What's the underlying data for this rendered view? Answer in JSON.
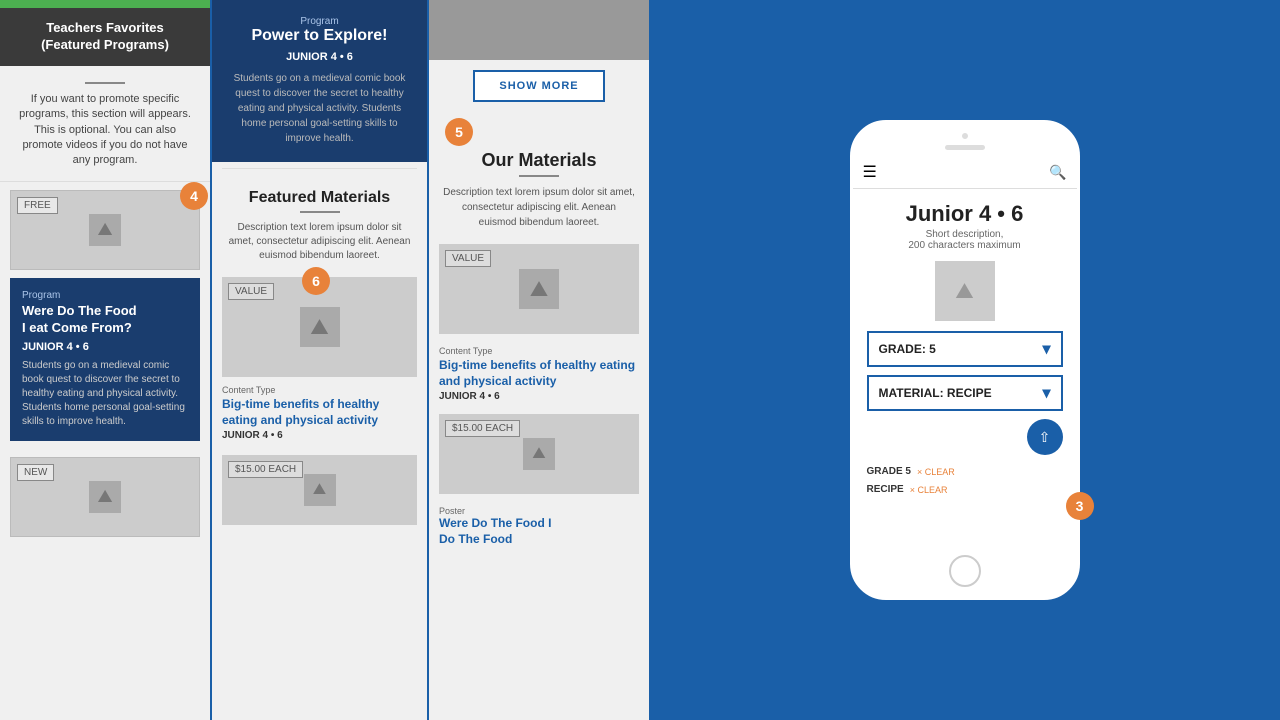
{
  "panel1": {
    "header": "Teachers Favorites\n(Featured Programs)",
    "description": "If you want to promote specific programs, this section will appears. This is optional. You can also promote videos if you do not have any program.",
    "badge4": "4",
    "free_tag": "FREE",
    "new_tag": "NEW",
    "program_label": "Program",
    "program_title": "Were Do The Food\nI eat Come From?",
    "program_grade": "JUNIOR 4 • 6",
    "program_desc": "Students go on a medieval comic book quest to discover the secret to healthy eating and physical activity. Students home personal goal-setting skills to improve health."
  },
  "panel2": {
    "program_label": "Program",
    "program_title": "Power to Explore!",
    "program_grade": "JUNIOR 4 • 6",
    "program_desc": "Students go on a medieval comic book quest to discover the secret to healthy eating and physical activity. Students home personal goal-setting skills to improve health.",
    "featured_title": "Featured Materials",
    "featured_desc": "Description text lorem ipsum dolor sit amet, consectetur adipiscing elit. Aenean euismod bibendum laoreet.",
    "badge6": "6",
    "value_tag": "VALUE",
    "content_type_label": "Content Type",
    "content_title": "Big-time benefits of healthy eating and physical activity",
    "content_grade": "JUNIOR 4 • 6",
    "price_tag": "$15.00 EACH"
  },
  "panel3": {
    "show_more": "SHOW MORE",
    "badge5": "5",
    "our_materials_title": "Our Materials",
    "our_materials_desc": "Description text lorem ipsum dolor sit amet, consectetur adipiscing elit. Aenean euismod bibendum laoreet.",
    "value_tag": "VALUE",
    "content_type_label": "Content Type",
    "content_title": "Big-time benefits of healthy eating and physical activity",
    "content_grade": "JUNIOR 4 • 6",
    "price_tag": "$15.00 EACH",
    "poster_label": "Poster",
    "poster_title": "Were Do The Food I\nDo The Food"
  },
  "phone": {
    "title": "Junior 4 • 6",
    "subtitle": "Short description,\n200 characters maximum",
    "grade_label": "GRADE: 5",
    "material_label": "MATERIAL: RECIPE",
    "badge3": "3",
    "share_icon": "⇧",
    "filter_grade": "GRADE 5",
    "filter_clear1": "× CLEAR",
    "filter_recipe": "RECIPE",
    "filter_clear2": "× CLEAR",
    "hamburger": "☰",
    "search": "🔍"
  }
}
